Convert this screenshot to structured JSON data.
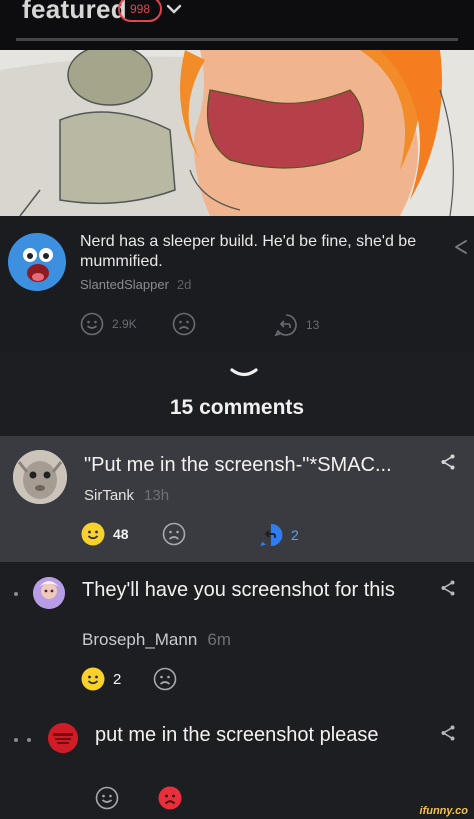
{
  "header": {
    "title": "featured",
    "badge_count": "998"
  },
  "post": {
    "text": "Nerd has a sleeper build. He'd be fine, she'd be mummified.",
    "author": "SlantedSlapper",
    "time": "2d",
    "smile_count": "2.9K",
    "reply_count": "13"
  },
  "comments_heading": "15 comments",
  "comments": [
    {
      "text": "\"Put me in the screensh-\"*SMAC...",
      "author": "SirTank",
      "time": "13h",
      "smile_count": "48",
      "reply_count": "2"
    },
    {
      "text": "They'll have you screenshot for this",
      "author": "Broseph_Mann",
      "time": "6m",
      "smile_count": "2"
    },
    {
      "text": "put me in the screenshot please"
    }
  ],
  "watermark": "ifunny.co",
  "colors": {
    "accent_red": "#e0474c",
    "smile_yellow": "#f8d22a",
    "reply_blue": "#2f7df0",
    "frown_red": "#e8303d"
  }
}
